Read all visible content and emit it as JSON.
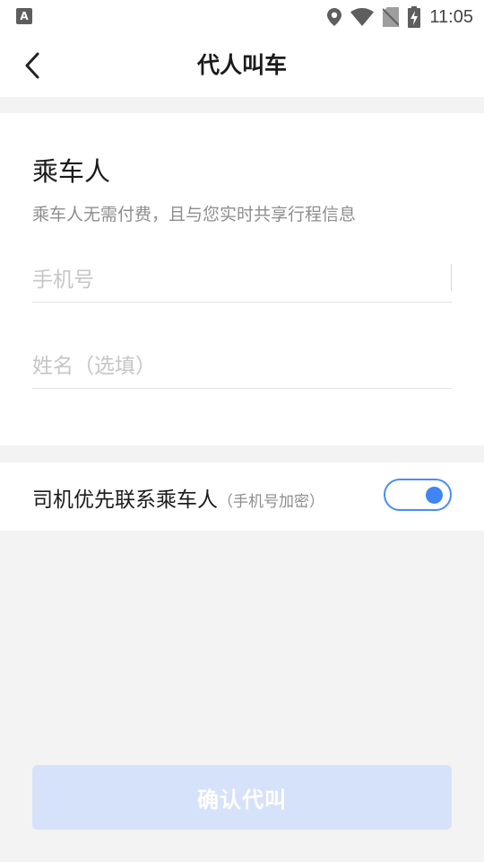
{
  "status_bar": {
    "left_icon_letter": "A",
    "time": "11:05"
  },
  "header": {
    "title": "代人叫车",
    "back_icon": "chevron-left-icon"
  },
  "passenger": {
    "title": "乘车人",
    "subtitle": "乘车人无需付费，且与您实时共享行程信息",
    "phone_placeholder": "手机号",
    "name_placeholder": "姓名（选填）"
  },
  "contact_toggle": {
    "label": "司机优先联系乘车人",
    "sub_label": "（手机号加密）",
    "enabled": true,
    "accent": "#3f86f4"
  },
  "confirm": {
    "label": "确认代叫",
    "background": "#d6e2f9"
  }
}
